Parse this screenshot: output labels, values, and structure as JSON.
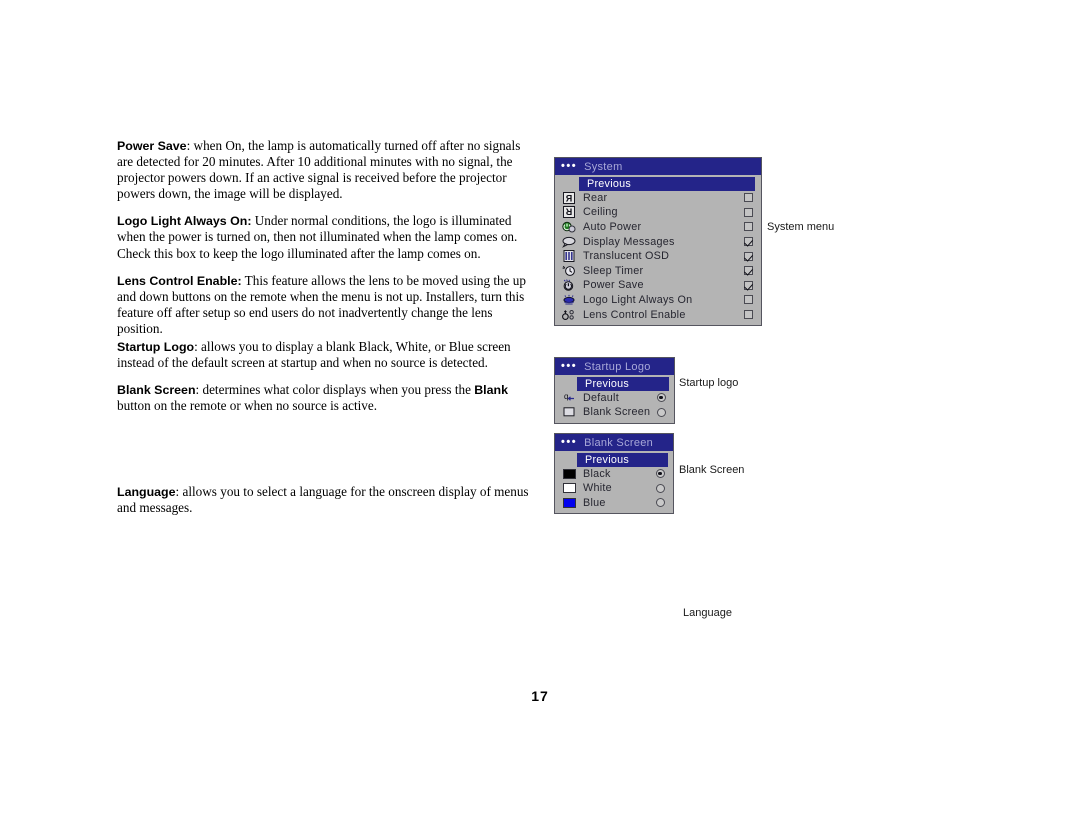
{
  "page": {
    "number": "17"
  },
  "body_text": {
    "blocks": [
      {
        "id": "power-save",
        "term": "Power Save",
        "rest": ": when On, the lamp is automatically turned off after no signals are detected for 20 minutes. After 10 additional minutes with no signal, the projector powers down. If an active signal is received before the projector powers down, the image will be displayed."
      },
      {
        "id": "logo-light-always-on",
        "term": "Logo Light Always On:",
        "rest": " Under normal conditions, the logo is illuminated when the power is turned on, then not illuminated when the lamp comes on. Check this box to keep the logo illuminated after the lamp comes on."
      },
      {
        "id": "lens-control-enable",
        "term": "Lens Control Enable:",
        "rest": " This feature allows the lens to be moved using the up and down buttons on the remote when the menu is not up. Installers, turn this feature off after setup so end users do not inadvertently change the lens position."
      },
      {
        "id": "startup-logo",
        "term": "Startup Logo",
        "rest": ": allows you to display a blank Black, White, or Blue screen instead of the default screen at startup and when no source is detected."
      },
      {
        "id": "blank-screen",
        "term": "Blank Screen",
        "rest": ": determines what color displays when you press the ",
        "term2": "Blank",
        "rest2": " button on the remote or when no source is active."
      },
      {
        "id": "language",
        "term": "Language",
        "rest": ": allows you to select a language for the onscreen display of menus and messages."
      }
    ]
  },
  "captions": {
    "system_menu": "System menu",
    "startup_logo": "Startup logo",
    "blank_screen": "Blank Screen",
    "language": "Language"
  },
  "colors": {
    "osd_title_bar": "#242489",
    "osd_background": "#b4b4b4",
    "osd_highlight": "#242489",
    "swatch_black": "#000000",
    "swatch_white": "#ffffff",
    "swatch_blue": "#0000ee"
  },
  "menus": {
    "system": {
      "title": "System",
      "dots": "•••",
      "previous": "Previous",
      "items": [
        {
          "icon": "rear-projection-icon",
          "label": "Rear",
          "control": "checkbox",
          "checked": false
        },
        {
          "icon": "ceiling-projection-icon",
          "label": "Ceiling",
          "control": "checkbox",
          "checked": false
        },
        {
          "icon": "auto-power-icon",
          "label": "Auto Power",
          "control": "checkbox",
          "checked": false
        },
        {
          "icon": "display-messages-icon",
          "label": "Display Messages",
          "control": "checkbox",
          "checked": true
        },
        {
          "icon": "translucent-osd-icon",
          "label": "Translucent OSD",
          "control": "checkbox",
          "checked": true
        },
        {
          "icon": "sleep-timer-icon",
          "label": "Sleep Timer",
          "control": "checkbox",
          "checked": true
        },
        {
          "icon": "power-save-icon",
          "label": "Power Save",
          "control": "checkbox",
          "checked": true
        },
        {
          "icon": "logo-light-icon",
          "label": "Logo Light Always On",
          "control": "checkbox",
          "checked": false
        },
        {
          "icon": "lens-control-icon",
          "label": "Lens Control Enable",
          "control": "checkbox",
          "checked": false
        }
      ]
    },
    "startup_logo": {
      "title": "Startup Logo",
      "dots": "•••",
      "previous": "Previous",
      "items": [
        {
          "icon": "default-logo-icon",
          "label": "Default",
          "control": "radio",
          "selected": true
        },
        {
          "icon": "blank-screen-icon",
          "label": "Blank Screen",
          "control": "radio",
          "selected": false
        }
      ]
    },
    "blank_screen": {
      "title": "Blank Screen",
      "dots": "•••",
      "previous": "Previous",
      "items": [
        {
          "icon": "swatch-black-icon",
          "label": "Black",
          "control": "radio",
          "selected": true,
          "swatch": "#000000"
        },
        {
          "icon": "swatch-white-icon",
          "label": "White",
          "control": "radio",
          "selected": false,
          "swatch": "#ffffff"
        },
        {
          "icon": "swatch-blue-icon",
          "label": "Blue",
          "control": "radio",
          "selected": false,
          "swatch": "#0000ee"
        }
      ]
    }
  }
}
